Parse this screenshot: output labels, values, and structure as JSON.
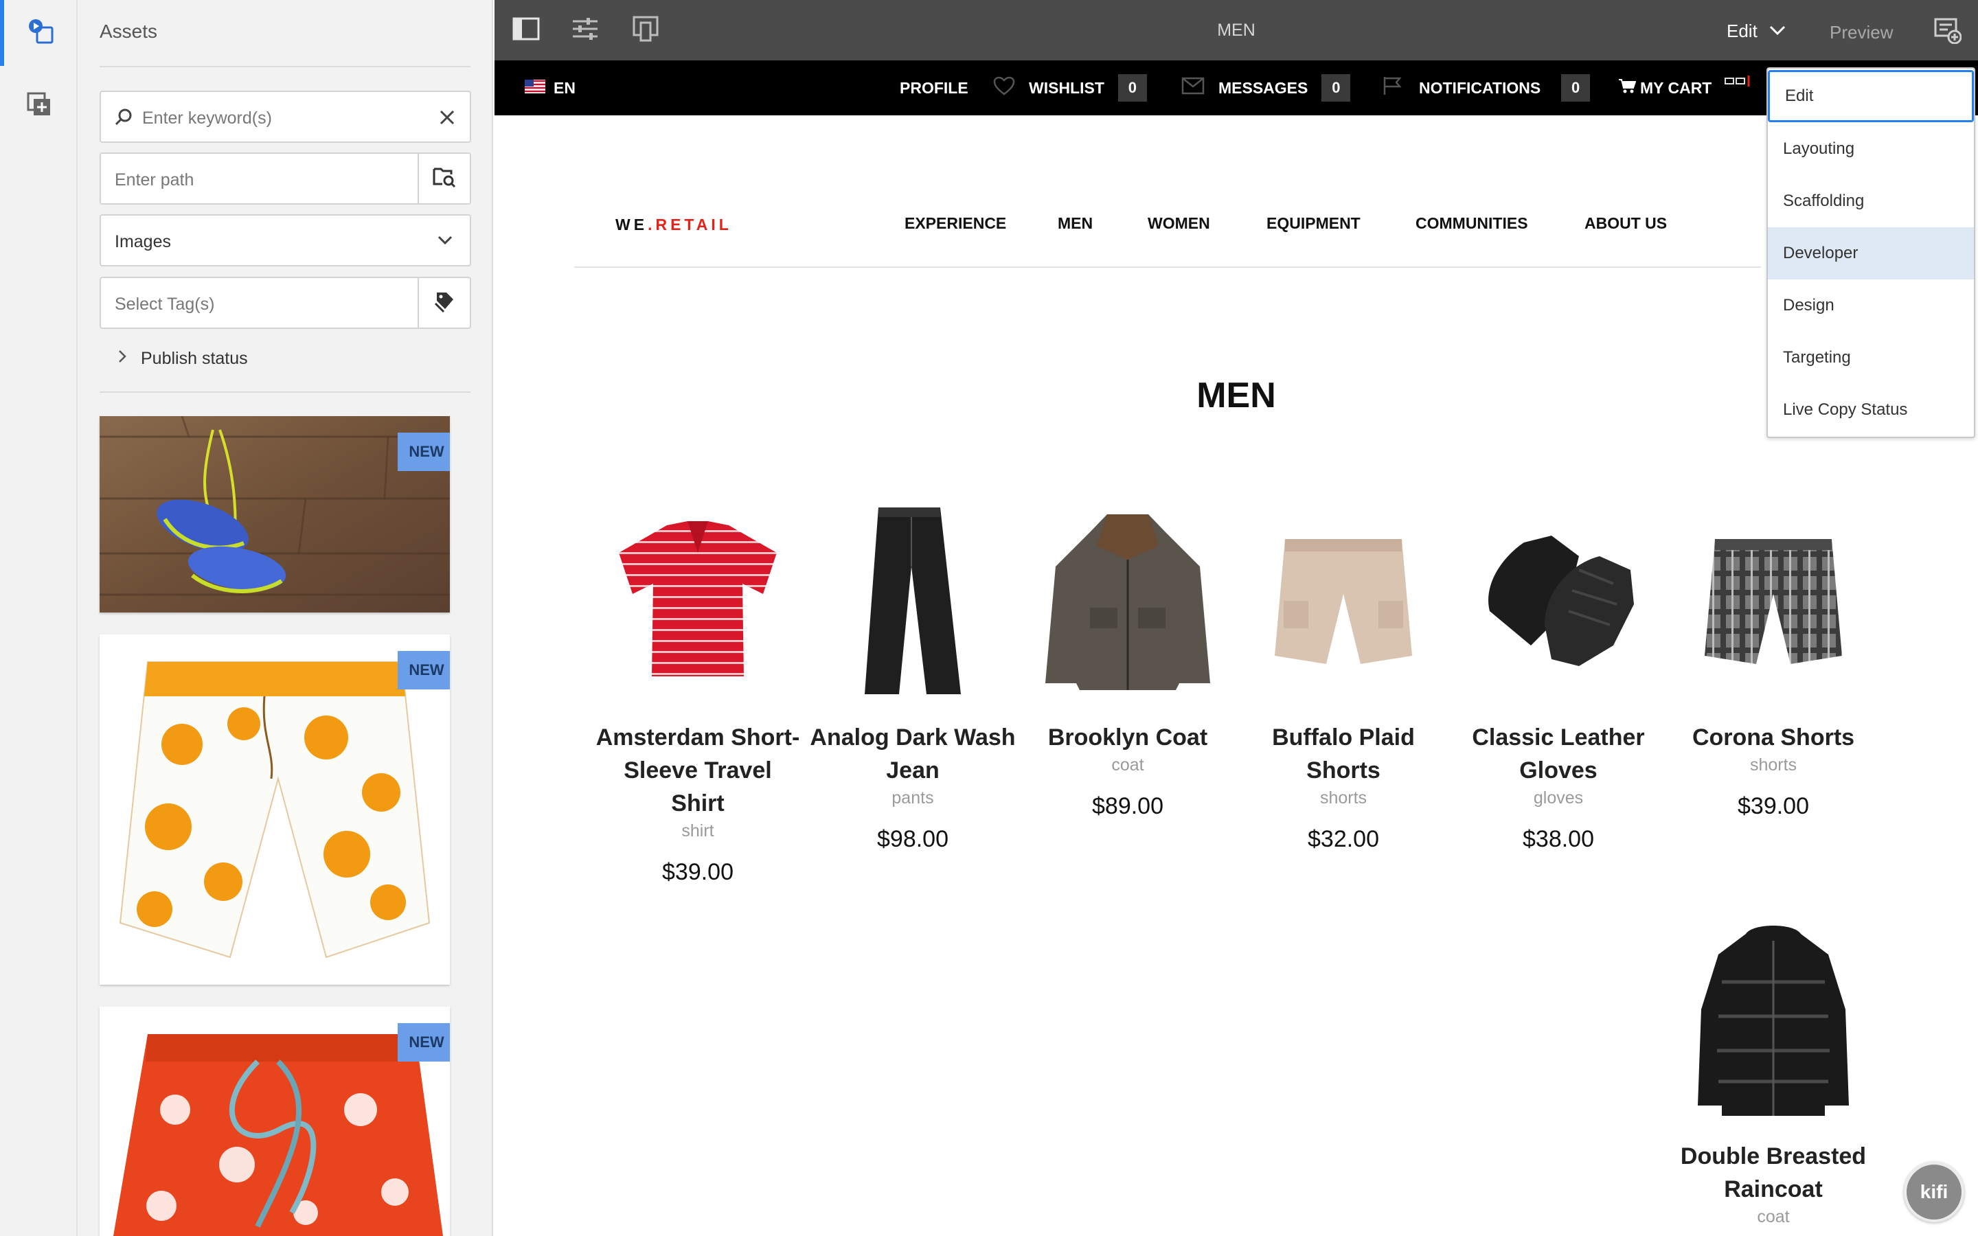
{
  "editor": {
    "page_title": "MEN",
    "mode_label": "Edit",
    "preview_label": "Preview"
  },
  "assets_panel": {
    "title": "Assets",
    "search_placeholder": "Enter keyword(s)",
    "path_placeholder": "Enter path",
    "type_select_value": "Images",
    "tags_placeholder": "Select Tag(s)",
    "publish_status_label": "Publish status",
    "badges": [
      "NEW",
      "NEW",
      "NEW"
    ]
  },
  "site_bar": {
    "language": "EN",
    "profile": "PROFILE",
    "wishlist": "WISHLIST",
    "wishlist_count": "0",
    "messages": "MESSAGES",
    "messages_count": "0",
    "notifications": "NOTIFICATIONS",
    "notifications_count": "0",
    "cart": "MY CART"
  },
  "site_header": {
    "logo_left": "WE",
    "logo_dot": ".",
    "logo_right": "RETAIL",
    "nav": [
      "EXPERIENCE",
      "MEN",
      "WOMEN",
      "EQUIPMENT",
      "COMMUNITIES",
      "ABOUT US"
    ]
  },
  "page": {
    "heading": "MEN",
    "products": [
      {
        "name": "Amsterdam Short-Sleeve Travel Shirt",
        "category": "shirt",
        "price": "$39.00"
      },
      {
        "name": "Analog Dark Wash Jean",
        "category": "pants",
        "price": "$98.00"
      },
      {
        "name": "Brooklyn Coat",
        "category": "coat",
        "price": "$89.00"
      },
      {
        "name": "Buffalo Plaid Shorts",
        "category": "shorts",
        "price": "$32.00"
      },
      {
        "name": "Classic Leather Gloves",
        "category": "gloves",
        "price": "$38.00"
      },
      {
        "name": "Corona Shorts",
        "category": "shorts",
        "price": "$39.00"
      },
      {
        "name": "Double Breasted Raincoat",
        "category": "coat",
        "price": ""
      }
    ]
  },
  "mode_menu": {
    "options": [
      "Edit",
      "Layouting",
      "Scaffolding",
      "Developer",
      "Design",
      "Targeting",
      "Live Copy Status"
    ],
    "selected": "Edit",
    "highlighted": "Developer"
  },
  "kifi_label": "kifi",
  "colors": {
    "accent_blue": "#2680eb",
    "brand_red": "#e2231a",
    "editor_bar": "#4b4b4b",
    "badge_blue": "#6a9ee8"
  }
}
